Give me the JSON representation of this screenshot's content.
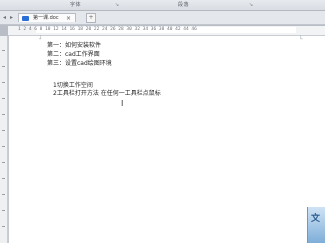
{
  "ribbon": {
    "groups": [
      "字体",
      "段落"
    ]
  },
  "tabs": {
    "document_title": "第一课.doc",
    "close_label": "×",
    "new_tab_label": "+"
  },
  "ruler": {
    "numbers": "1 2 4 6 8 10 12 14 16 18 20 22 24 26 28 30 32 34 36 38 40 42 44 46"
  },
  "document": {
    "lines": [
      "第一：如何安装软件",
      "第二：cad工作界面",
      "第三：设置cad绘图环境",
      "",
      "1切换工作空间",
      "2工具栏打开方法    在任何一工具栏点鼠标"
    ]
  },
  "cursor": {
    "glyph": "I"
  },
  "thumbnail": {
    "glyph": "文"
  }
}
